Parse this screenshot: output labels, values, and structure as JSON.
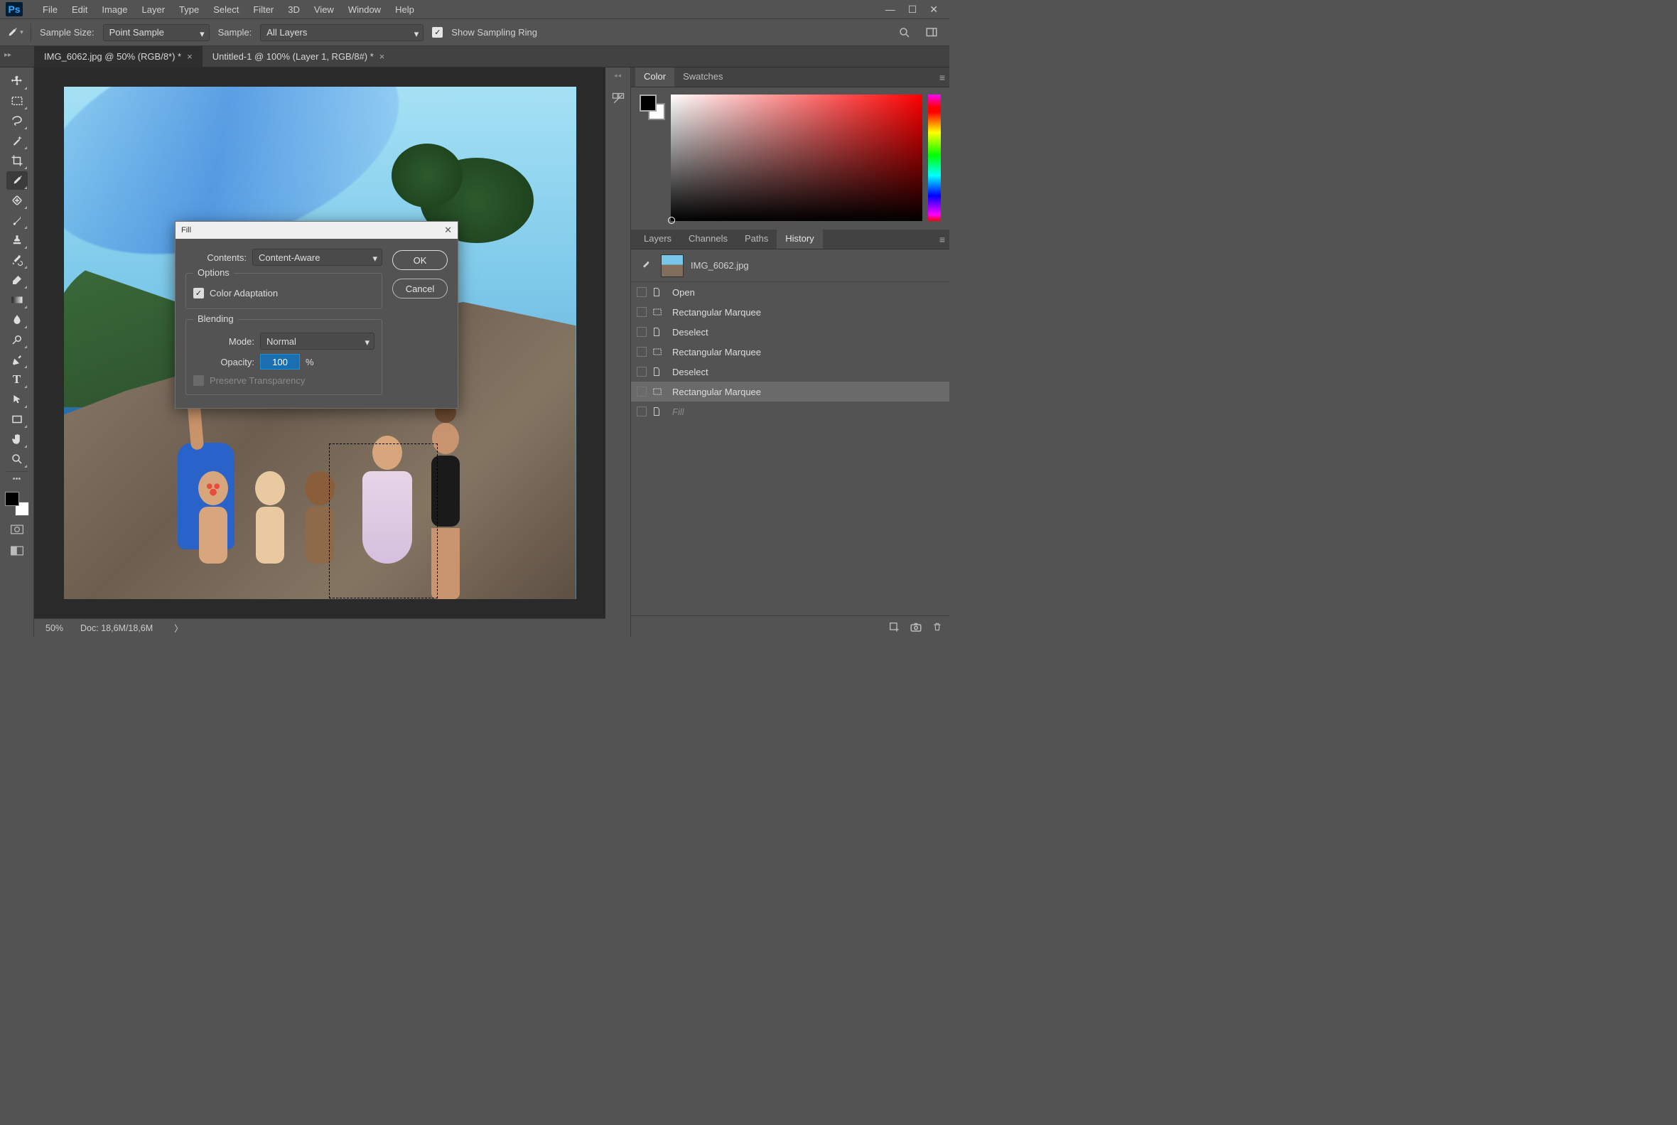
{
  "menubar": {
    "items": [
      "File",
      "Edit",
      "Image",
      "Layer",
      "Type",
      "Select",
      "Filter",
      "3D",
      "View",
      "Window",
      "Help"
    ]
  },
  "optionsbar": {
    "sample_size_label": "Sample Size:",
    "sample_size_value": "Point Sample",
    "sample_label": "Sample:",
    "sample_value": "All Layers",
    "show_sampling_ring": "Show Sampling Ring"
  },
  "tabs": [
    {
      "label": "IMG_6062.jpg @ 50% (RGB/8*) *",
      "active": true
    },
    {
      "label": "Untitled-1 @ 100% (Layer 1, RGB/8#) *",
      "active": false
    }
  ],
  "statusbar": {
    "zoom": "50%",
    "doc": "Doc: 18,6M/18,6M"
  },
  "panels": {
    "color_tabs": [
      "Color",
      "Swatches"
    ],
    "color_active": "Color",
    "lower_tabs": [
      "Layers",
      "Channels",
      "Paths",
      "History"
    ],
    "lower_active": "History",
    "history_doc": "IMG_6062.jpg",
    "history": [
      {
        "label": "Open",
        "icon": "doc"
      },
      {
        "label": "Rectangular Marquee",
        "icon": "marquee"
      },
      {
        "label": "Deselect",
        "icon": "doc"
      },
      {
        "label": "Rectangular Marquee",
        "icon": "marquee"
      },
      {
        "label": "Deselect",
        "icon": "doc"
      },
      {
        "label": "Rectangular Marquee",
        "icon": "marquee",
        "current": true
      },
      {
        "label": "Fill",
        "icon": "doc",
        "future": true
      }
    ]
  },
  "dialog": {
    "title": "Fill",
    "contents_label": "Contents:",
    "contents_value": "Content-Aware",
    "options_legend": "Options",
    "color_adaptation": "Color Adaptation",
    "blending_legend": "Blending",
    "mode_label": "Mode:",
    "mode_value": "Normal",
    "opacity_label": "Opacity:",
    "opacity_value": "100",
    "opacity_suffix": "%",
    "preserve": "Preserve Transparency",
    "ok": "OK",
    "cancel": "Cancel"
  },
  "tools": [
    "move",
    "rect-marquee",
    "lasso",
    "magic-wand",
    "crop",
    "eyedropper",
    "healing",
    "brush",
    "stamp",
    "history-brush",
    "eraser",
    "gradient",
    "blur",
    "dodge",
    "pen",
    "type",
    "path-select",
    "rectangle",
    "hand",
    "zoom"
  ],
  "swatches": {
    "fg": "#000000",
    "bg": "#ffffff"
  }
}
